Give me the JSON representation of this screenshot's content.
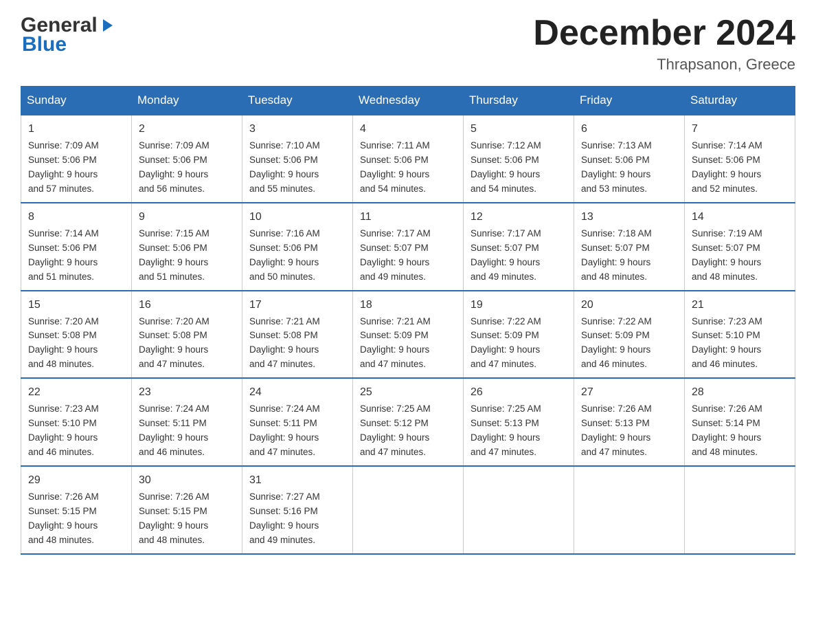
{
  "logo": {
    "general": "General",
    "blue": "Blue",
    "arrow": "▶"
  },
  "title": "December 2024",
  "location": "Thrapsanon, Greece",
  "weekdays": [
    "Sunday",
    "Monday",
    "Tuesday",
    "Wednesday",
    "Thursday",
    "Friday",
    "Saturday"
  ],
  "weeks": [
    [
      {
        "day": "1",
        "sunrise": "7:09 AM",
        "sunset": "5:06 PM",
        "daylight": "9 hours and 57 minutes."
      },
      {
        "day": "2",
        "sunrise": "7:09 AM",
        "sunset": "5:06 PM",
        "daylight": "9 hours and 56 minutes."
      },
      {
        "day": "3",
        "sunrise": "7:10 AM",
        "sunset": "5:06 PM",
        "daylight": "9 hours and 55 minutes."
      },
      {
        "day": "4",
        "sunrise": "7:11 AM",
        "sunset": "5:06 PM",
        "daylight": "9 hours and 54 minutes."
      },
      {
        "day": "5",
        "sunrise": "7:12 AM",
        "sunset": "5:06 PM",
        "daylight": "9 hours and 54 minutes."
      },
      {
        "day": "6",
        "sunrise": "7:13 AM",
        "sunset": "5:06 PM",
        "daylight": "9 hours and 53 minutes."
      },
      {
        "day": "7",
        "sunrise": "7:14 AM",
        "sunset": "5:06 PM",
        "daylight": "9 hours and 52 minutes."
      }
    ],
    [
      {
        "day": "8",
        "sunrise": "7:14 AM",
        "sunset": "5:06 PM",
        "daylight": "9 hours and 51 minutes."
      },
      {
        "day": "9",
        "sunrise": "7:15 AM",
        "sunset": "5:06 PM",
        "daylight": "9 hours and 51 minutes."
      },
      {
        "day": "10",
        "sunrise": "7:16 AM",
        "sunset": "5:06 PM",
        "daylight": "9 hours and 50 minutes."
      },
      {
        "day": "11",
        "sunrise": "7:17 AM",
        "sunset": "5:07 PM",
        "daylight": "9 hours and 49 minutes."
      },
      {
        "day": "12",
        "sunrise": "7:17 AM",
        "sunset": "5:07 PM",
        "daylight": "9 hours and 49 minutes."
      },
      {
        "day": "13",
        "sunrise": "7:18 AM",
        "sunset": "5:07 PM",
        "daylight": "9 hours and 48 minutes."
      },
      {
        "day": "14",
        "sunrise": "7:19 AM",
        "sunset": "5:07 PM",
        "daylight": "9 hours and 48 minutes."
      }
    ],
    [
      {
        "day": "15",
        "sunrise": "7:20 AM",
        "sunset": "5:08 PM",
        "daylight": "9 hours and 48 minutes."
      },
      {
        "day": "16",
        "sunrise": "7:20 AM",
        "sunset": "5:08 PM",
        "daylight": "9 hours and 47 minutes."
      },
      {
        "day": "17",
        "sunrise": "7:21 AM",
        "sunset": "5:08 PM",
        "daylight": "9 hours and 47 minutes."
      },
      {
        "day": "18",
        "sunrise": "7:21 AM",
        "sunset": "5:09 PM",
        "daylight": "9 hours and 47 minutes."
      },
      {
        "day": "19",
        "sunrise": "7:22 AM",
        "sunset": "5:09 PM",
        "daylight": "9 hours and 47 minutes."
      },
      {
        "day": "20",
        "sunrise": "7:22 AM",
        "sunset": "5:09 PM",
        "daylight": "9 hours and 46 minutes."
      },
      {
        "day": "21",
        "sunrise": "7:23 AM",
        "sunset": "5:10 PM",
        "daylight": "9 hours and 46 minutes."
      }
    ],
    [
      {
        "day": "22",
        "sunrise": "7:23 AM",
        "sunset": "5:10 PM",
        "daylight": "9 hours and 46 minutes."
      },
      {
        "day": "23",
        "sunrise": "7:24 AM",
        "sunset": "5:11 PM",
        "daylight": "9 hours and 46 minutes."
      },
      {
        "day": "24",
        "sunrise": "7:24 AM",
        "sunset": "5:11 PM",
        "daylight": "9 hours and 47 minutes."
      },
      {
        "day": "25",
        "sunrise": "7:25 AM",
        "sunset": "5:12 PM",
        "daylight": "9 hours and 47 minutes."
      },
      {
        "day": "26",
        "sunrise": "7:25 AM",
        "sunset": "5:13 PM",
        "daylight": "9 hours and 47 minutes."
      },
      {
        "day": "27",
        "sunrise": "7:26 AM",
        "sunset": "5:13 PM",
        "daylight": "9 hours and 47 minutes."
      },
      {
        "day": "28",
        "sunrise": "7:26 AM",
        "sunset": "5:14 PM",
        "daylight": "9 hours and 48 minutes."
      }
    ],
    [
      {
        "day": "29",
        "sunrise": "7:26 AM",
        "sunset": "5:15 PM",
        "daylight": "9 hours and 48 minutes."
      },
      {
        "day": "30",
        "sunrise": "7:26 AM",
        "sunset": "5:15 PM",
        "daylight": "9 hours and 48 minutes."
      },
      {
        "day": "31",
        "sunrise": "7:27 AM",
        "sunset": "5:16 PM",
        "daylight": "9 hours and 49 minutes."
      },
      null,
      null,
      null,
      null
    ]
  ]
}
